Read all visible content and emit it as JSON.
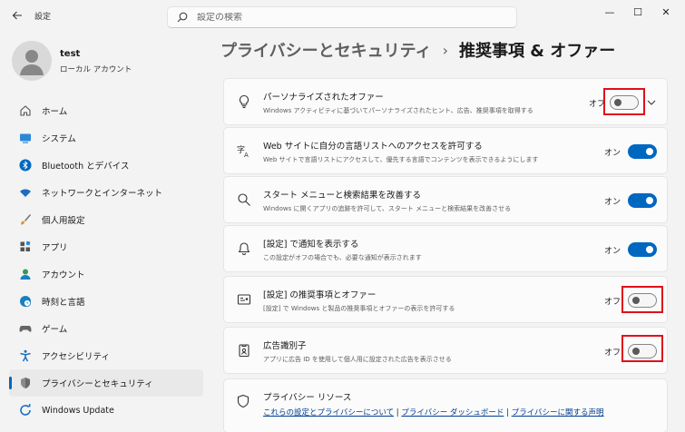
{
  "window": {
    "title": "設定",
    "minimize": "—",
    "maximize": "☐",
    "close": "✕"
  },
  "search": {
    "placeholder": "設定の検索"
  },
  "user": {
    "name": "test",
    "account_type": "ローカル アカウント"
  },
  "nav": [
    {
      "label": "ホーム",
      "icon": "home-icon"
    },
    {
      "label": "システム",
      "icon": "system-icon"
    },
    {
      "label": "Bluetooth とデバイス",
      "icon": "bluetooth-icon"
    },
    {
      "label": "ネットワークとインターネット",
      "icon": "wifi-icon"
    },
    {
      "label": "個人用設定",
      "icon": "brush-icon"
    },
    {
      "label": "アプリ",
      "icon": "apps-icon"
    },
    {
      "label": "アカウント",
      "icon": "account-icon"
    },
    {
      "label": "時刻と言語",
      "icon": "globe-clock-icon"
    },
    {
      "label": "ゲーム",
      "icon": "gamepad-icon"
    },
    {
      "label": "アクセシビリティ",
      "icon": "accessibility-icon"
    },
    {
      "label": "プライバシーとセキュリティ",
      "icon": "shield-icon"
    },
    {
      "label": "Windows Update",
      "icon": "windows-update-icon"
    }
  ],
  "breadcrumb": {
    "parent": "プライバシーとセキュリティ",
    "separator": "›",
    "current": "推奨事項 & オファー"
  },
  "settings": [
    {
      "title": "パーソナライズされたオファー",
      "desc": "Windows アクティビティに基づいてパーソナライズされたヒント、広告、推奨事項を取得する",
      "state": "オフ",
      "on": false,
      "highlight": true,
      "chevron": true,
      "icon": "lightbulb-icon"
    },
    {
      "title": "Web サイトに自分の言語リストへのアクセスを許可する",
      "desc": "Web サイトで言語リストにアクセスして、優先する言語でコンテンツを表示できるようにします",
      "state": "オン",
      "on": true,
      "highlight": false,
      "chevron": false,
      "icon": "language-icon"
    },
    {
      "title": "スタート メニューと検索結果を改善する",
      "desc": "Windows に開くアプリの追跡を許可して、スタート メニューと検索結果を改善させる",
      "state": "オン",
      "on": true,
      "highlight": false,
      "chevron": false,
      "icon": "search-icon"
    },
    {
      "title": "[設定] で通知を表示する",
      "desc": "この設定がオフの場合でも、必要な通知が表示されます",
      "state": "オン",
      "on": true,
      "highlight": false,
      "chevron": false,
      "icon": "bell-icon"
    },
    {
      "title": "[設定] の推奨事項とオファー",
      "desc": "[設定] で Windows と製品の推奨事項とオファーの表示を許可する",
      "state": "オフ",
      "on": false,
      "highlight": true,
      "chevron": false,
      "icon": "settings-card-icon"
    },
    {
      "title": "広告識別子",
      "desc": "アプリに広告 ID を使用して個人用に設定された広告を表示させる",
      "state": "オフ",
      "on": false,
      "highlight": true,
      "chevron": false,
      "icon": "ad-id-icon"
    }
  ],
  "privacy_resources": {
    "title": "プライバシー リソース",
    "link1": "これらの設定とプライバシーについて",
    "sep": " | ",
    "link2": "プライバシー ダッシュボード",
    "link3": "プライバシーに関する声明"
  },
  "colors": {
    "accent": "#0067c0",
    "highlight": "#e0101a",
    "link": "#003e92"
  }
}
